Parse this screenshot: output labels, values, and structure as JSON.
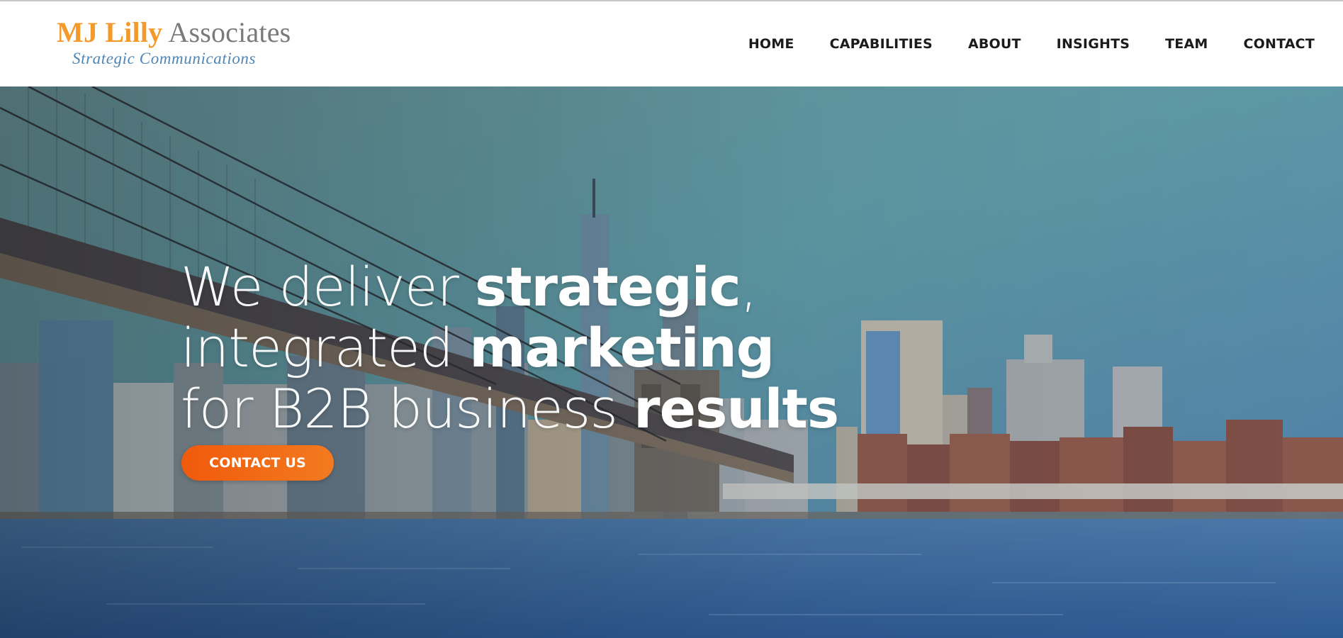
{
  "brand": {
    "name_highlight": "MJ Lilly",
    "name_rest": " Associates",
    "tagline": "Strategic Communications"
  },
  "nav": {
    "items": [
      "HOME",
      "CAPABILITIES",
      "ABOUT",
      "INSIGHTS",
      "TEAM",
      "CONTACT"
    ]
  },
  "hero": {
    "line1_light": "We deliver ",
    "line1_bold": "strategic",
    "line1_tail": ",",
    "line2_light": "integrated ",
    "line2_bold": "marketing",
    "line3_light": "for B2B business ",
    "line3_bold": "results",
    "cta_label": "CONTACT US"
  },
  "colors": {
    "brand_orange": "#f39a2b",
    "brand_grey": "#7a7a7a",
    "tagline_blue": "#4f86b5",
    "cta_orange": "#f05a0c"
  }
}
